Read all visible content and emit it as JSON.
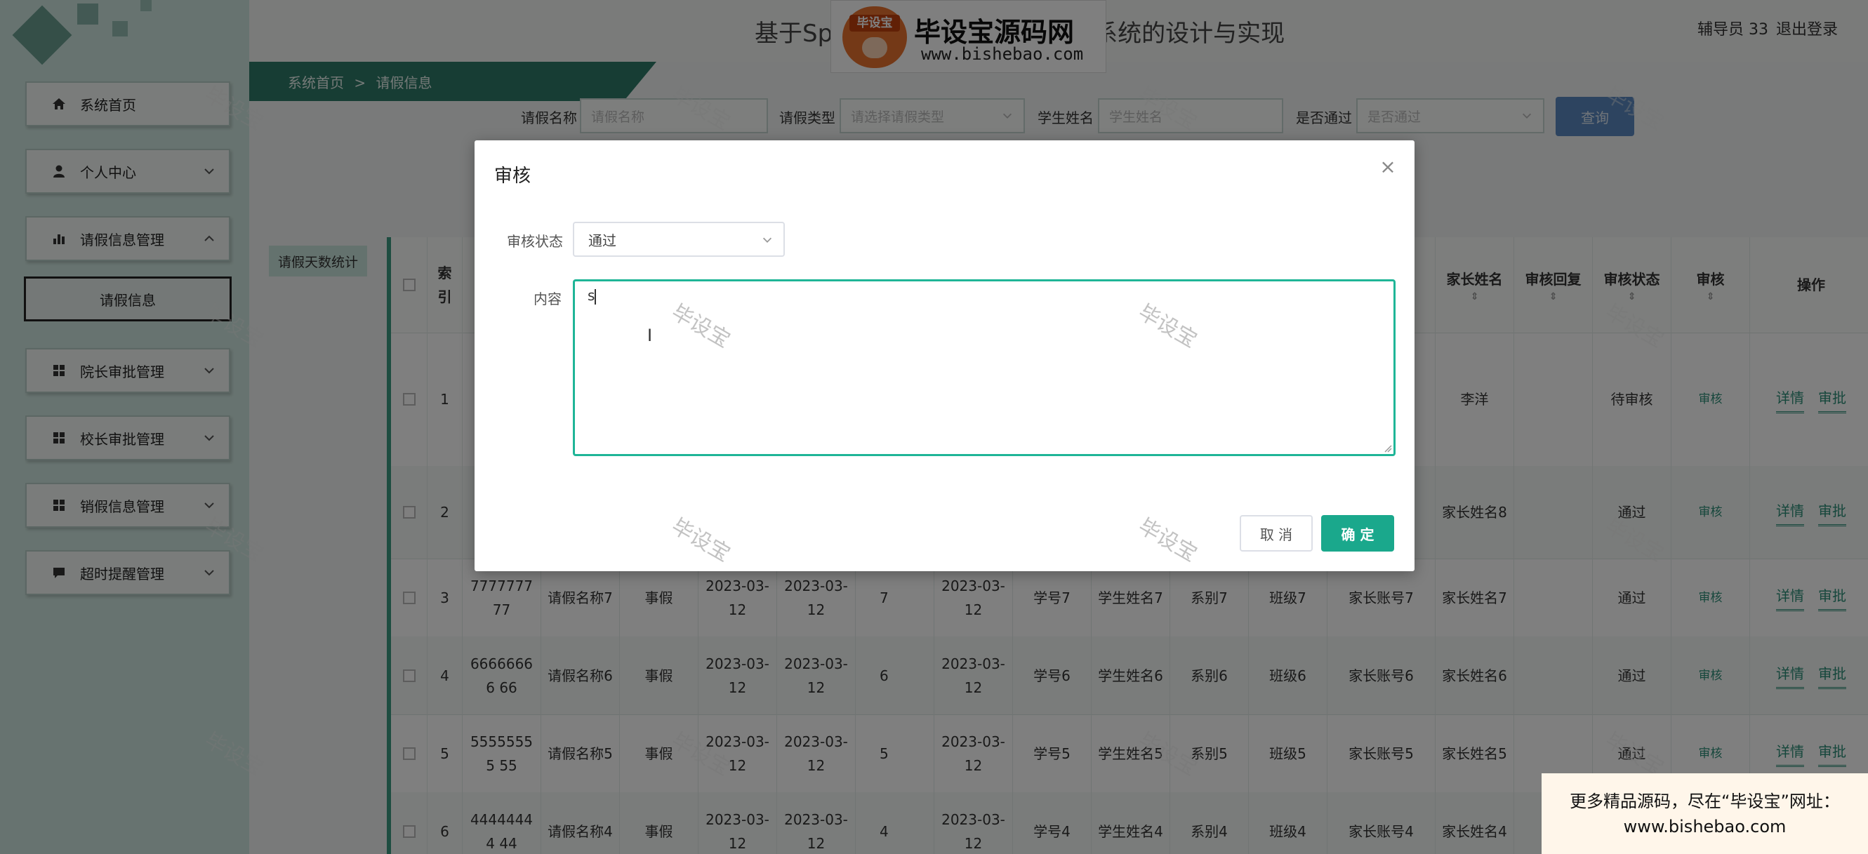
{
  "header": {
    "title": "基于Sp... 系统的设计与实现",
    "title_left": "基于Sp",
    "title_right": "系统的设计与实现",
    "user": "辅导员 33",
    "logout": "退出登录"
  },
  "watermark_logo": {
    "badge": "毕设宝",
    "name": "毕设宝源码网",
    "url": "www.bishebao.com"
  },
  "breadcrumb": {
    "home": "系统首页",
    "sep": ">",
    "current": "请假信息"
  },
  "sidebar": {
    "items": [
      {
        "label": "系统首页",
        "icon": "home-icon"
      },
      {
        "label": "个人中心",
        "icon": "user-icon"
      },
      {
        "label": "请假信息管理",
        "icon": "bar-chart-icon"
      },
      {
        "label": "院长审批管理",
        "icon": "grid-icon"
      },
      {
        "label": "校长审批管理",
        "icon": "grid-icon"
      },
      {
        "label": "销假信息管理",
        "icon": "grid-icon"
      },
      {
        "label": "超时提醒管理",
        "icon": "message-icon"
      }
    ],
    "submenu": "请假信息"
  },
  "search": {
    "leave_name_label": "请假名称",
    "leave_name_placeholder": "请假名称",
    "leave_type_label": "请假类型",
    "leave_type_placeholder": "请选择请假类型",
    "student_name_label": "学生姓名",
    "student_name_placeholder": "学生姓名",
    "passed_label": "是否通过",
    "passed_placeholder": "是否通过",
    "query_button": "查询"
  },
  "stats_button": "请假天数统计",
  "table": {
    "headers": {
      "index": "索引",
      "parent_name": "家长姓名",
      "audit_reply": "审核回复",
      "audit_status": "审核状态",
      "audit": "审核",
      "operation": "操作"
    },
    "rows": [
      {
        "index": "1",
        "parent_name": "李洋",
        "status": "待审核",
        "audit": "审核",
        "detail": "详情",
        "approve": "审批"
      },
      {
        "index": "2",
        "parent_name": "家长姓名8",
        "status": "通过",
        "audit": "审核",
        "detail": "详情",
        "approve": "审批"
      },
      {
        "index": "3",
        "code": "777777777",
        "leave_name": "请假名称7",
        "type": "事假",
        "start": "2023-03-12",
        "end": "2023-03-12",
        "days": "7",
        "apply": "2023-03-12",
        "student_no": "学号7",
        "student_name": "学生姓名7",
        "dept": "系别7",
        "class": "班级7",
        "parent_account": "家长账号7",
        "parent_name": "家长姓名7",
        "status": "通过",
        "audit": "审核",
        "detail": "详情",
        "approve": "审批"
      },
      {
        "index": "4",
        "code": "66666666 66",
        "leave_name": "请假名称6",
        "type": "事假",
        "start": "2023-03-12",
        "end": "2023-03-12",
        "days": "6",
        "apply": "2023-03-12",
        "student_no": "学号6",
        "student_name": "学生姓名6",
        "dept": "系别6",
        "class": "班级6",
        "parent_account": "家长账号6",
        "parent_name": "家长姓名6",
        "status": "通过",
        "audit": "审核",
        "detail": "详情",
        "approve": "审批"
      },
      {
        "index": "5",
        "code": "55555555 55",
        "leave_name": "请假名称5",
        "type": "事假",
        "start": "2023-03-12",
        "end": "2023-03-12",
        "days": "5",
        "apply": "2023-03-12",
        "student_no": "学号5",
        "student_name": "学生姓名5",
        "dept": "系别5",
        "class": "班级5",
        "parent_account": "家长账号5",
        "parent_name": "家长姓名5",
        "status": "通过",
        "audit": "审核",
        "detail": "详情",
        "approve": "审批"
      },
      {
        "index": "6",
        "code": "44444444 44",
        "leave_name": "请假名称4",
        "type": "事假",
        "start": "2023-03-12",
        "end": "2023-03-12",
        "days": "4",
        "apply": "2023-03-12",
        "student_no": "学号4",
        "student_name": "学生姓名4",
        "dept": "系别4",
        "class": "班级4",
        "parent_account": "家长账号4",
        "parent_name": "家长姓名4",
        "status": "通过",
        "audit": "审核",
        "detail": "详情",
        "approve": "审批"
      }
    ]
  },
  "dialog": {
    "title": "审核",
    "status_label": "审核状态",
    "status_value": "通过",
    "content_label": "内容",
    "content_value": "s",
    "cancel": "取 消",
    "confirm": "确 定"
  },
  "watermark_text": "毕设宝",
  "promo": {
    "line1": "更多精品源码，尽在“毕设宝”网址：",
    "line2": "www.bishebao.com"
  },
  "colors": {
    "accent": "#1aa88c",
    "sidebar_bg": "#cfe7e0",
    "query_button": "#5a89c0"
  }
}
